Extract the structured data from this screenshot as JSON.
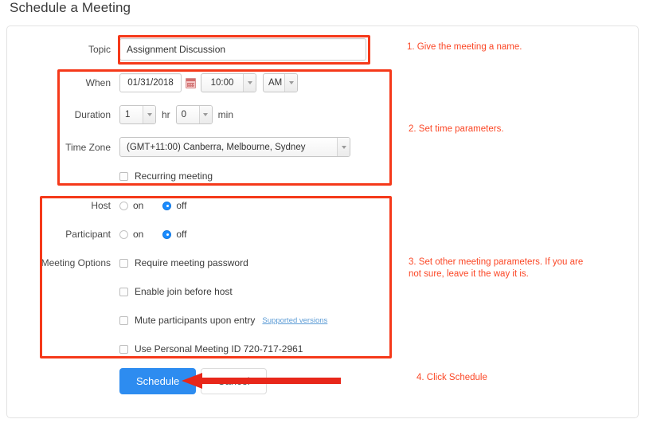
{
  "page": {
    "title": "Schedule a Meeting"
  },
  "form": {
    "topic": {
      "label": "Topic",
      "value": "Assignment Discussion",
      "placeholder": ""
    },
    "when": {
      "label": "When",
      "date": "01/31/2018",
      "calendar_icon": "calendar-icon",
      "time": "10:00",
      "meridiem": "AM"
    },
    "duration": {
      "label": "Duration",
      "hours": "1",
      "hours_unit": "hr",
      "minutes": "0",
      "minutes_unit": "min"
    },
    "timezone": {
      "label": "Time Zone",
      "value": "(GMT+11:00) Canberra, Melbourne, Sydney"
    },
    "recurring": {
      "label": "Recurring meeting",
      "checked": false
    },
    "host": {
      "label": "Host",
      "on_label": "on",
      "off_label": "off",
      "selected": "off"
    },
    "participant": {
      "label": "Participant",
      "on_label": "on",
      "off_label": "off",
      "selected": "off"
    },
    "meeting_options": {
      "label": "Meeting Options",
      "items": [
        {
          "label": "Require meeting password",
          "checked": false,
          "link": ""
        },
        {
          "label": "Enable join before host",
          "checked": false,
          "link": ""
        },
        {
          "label": "Mute participants upon entry",
          "checked": false,
          "link": "Supported versions"
        },
        {
          "label": "Use Personal Meeting ID 720-717-2961",
          "checked": false,
          "link": ""
        }
      ]
    },
    "actions": {
      "schedule_label": "Schedule",
      "cancel_label": "Cancel"
    }
  },
  "annotations": {
    "note1": "1. Give the meeting a name.",
    "note2": "2. Set time parameters.",
    "note3_line1": "3. Set other meeting parameters. If you are",
    "note3_line2": "not sure, leave it the way it is.",
    "note4": "4. Click Schedule"
  },
  "colors": {
    "annotation_red": "#fb4726",
    "highlight_box": "#f5391a",
    "primary_button": "#2d8cf0",
    "radio_selected": "#1a8cff",
    "link_blue": "#5b9bd5"
  }
}
